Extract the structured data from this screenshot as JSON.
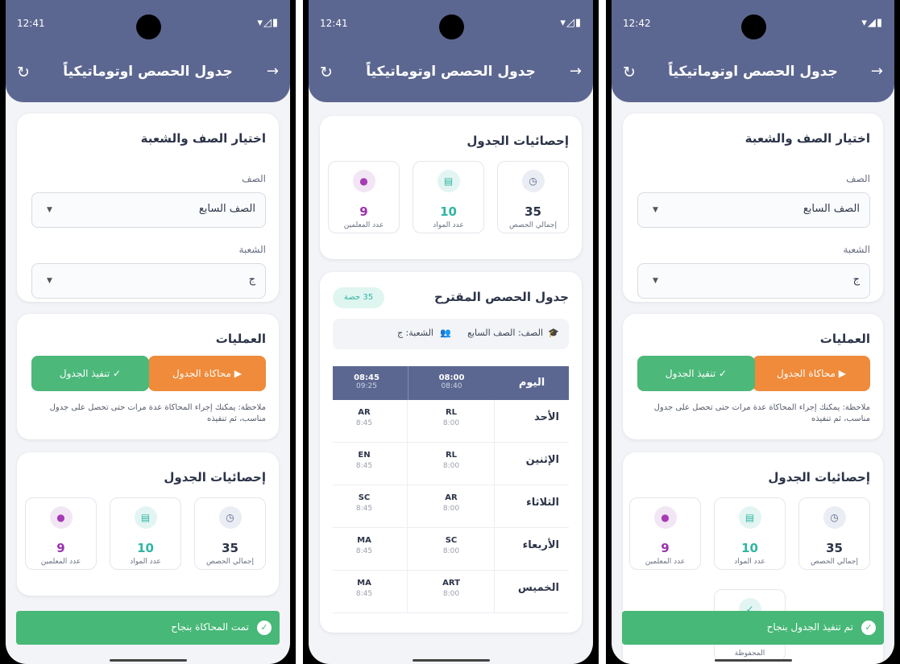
{
  "app": {
    "title": "جدول الحصص اوتوماتيكياً",
    "refresh_icon": "refresh-icon",
    "back_icon": "arrow-back-icon"
  },
  "status_times": [
    "12:41",
    "12:41",
    "12:42"
  ],
  "selection": {
    "title": "اختيار الصف والشعبة",
    "class_label": "الصف",
    "class_value": "الصف السابع",
    "section_label": "الشعبة",
    "section_value": "ج"
  },
  "operations": {
    "title": "العمليات",
    "simulate_label": "محاكاة الجدول",
    "execute_label": "تنفيذ الجدول",
    "note": "ملاحظة: يمكنك إجراء المحاكاة عدة مرات حتى تحصل على جدول مناسب، ثم تنفيذه"
  },
  "stats": {
    "title": "إحصائيات الجدول",
    "items": [
      {
        "icon": "clock-icon",
        "value": "35",
        "label": "إجمالي الحصص"
      },
      {
        "icon": "book-icon",
        "value": "10",
        "label": "عدد المواد"
      },
      {
        "icon": "person-icon",
        "value": "9",
        "label": "عدد المعلمين"
      }
    ],
    "saved_label": "المحفوظة"
  },
  "schedule": {
    "title": "جدول الحصص المقترح",
    "badge": "35 حصة",
    "class_info": "الصف: الصف السابع",
    "section_info": "الشعبة: ج",
    "day_header": "اليوم",
    "periods": [
      {
        "start": "08:00",
        "end": "08:40"
      },
      {
        "start": "08:45",
        "end": "09:25"
      }
    ],
    "rows": [
      {
        "day": "الأحد",
        "cells": [
          {
            "subject": "RL",
            "time": "8:00"
          },
          {
            "subject": "AR",
            "time": "8:45"
          }
        ]
      },
      {
        "day": "الإثنين",
        "cells": [
          {
            "subject": "RL",
            "time": "8:00"
          },
          {
            "subject": "EN",
            "time": "8:45"
          }
        ]
      },
      {
        "day": "الثلاثاء",
        "cells": [
          {
            "subject": "AR",
            "time": "8:00"
          },
          {
            "subject": "SC",
            "time": "8:45"
          }
        ]
      },
      {
        "day": "الأربعاء",
        "cells": [
          {
            "subject": "SC",
            "time": "8:00"
          },
          {
            "subject": "MA",
            "time": "8:45"
          }
        ]
      },
      {
        "day": "الخميس",
        "cells": [
          {
            "subject": "ART",
            "time": "8:00"
          },
          {
            "subject": "MA",
            "time": "8:45"
          }
        ]
      }
    ]
  },
  "toasts": {
    "simulate_success": "تمت المحاكاة بنجاح",
    "execute_success": "تم تنفيذ الجدول بنجاح"
  },
  "colors": {
    "primary": "#5c6791",
    "orange": "#ef8b3a",
    "green": "#4cb87a",
    "teal": "#30b6a3",
    "purple": "#9c2fb0"
  }
}
